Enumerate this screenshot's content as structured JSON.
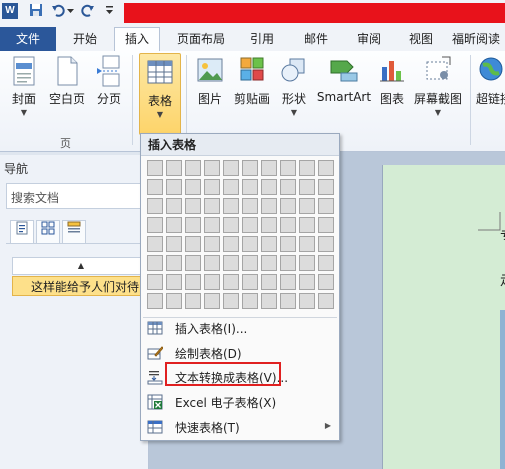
{
  "titlebar": {
    "app_icon_letter": "W",
    "qa_buttons": [
      "save-icon",
      "undo-icon",
      "undo-dropdown-icon",
      "redo-icon",
      "customize-icon"
    ]
  },
  "tabs": [
    {
      "label": "文件",
      "kind": "file"
    },
    {
      "label": "开始"
    },
    {
      "label": "插入",
      "active": true
    },
    {
      "label": "页面布局"
    },
    {
      "label": "引用"
    },
    {
      "label": "邮件"
    },
    {
      "label": "审阅"
    },
    {
      "label": "视图"
    },
    {
      "label": "福昕阅读"
    }
  ],
  "ribbon": {
    "pages_group": {
      "label": "页",
      "buttons": [
        {
          "label": "封面",
          "has_dropdown": true
        },
        {
          "label": "空白页"
        },
        {
          "label": "分页"
        }
      ]
    },
    "table_button": {
      "label": "表格",
      "has_dropdown": true
    },
    "illustrations": [
      {
        "label": "图片"
      },
      {
        "label": "剪贴画"
      },
      {
        "label": "形状",
        "has_dropdown": true
      },
      {
        "label": "SmartArt"
      },
      {
        "label": "图表"
      },
      {
        "label": "屏幕截图",
        "has_dropdown": true
      },
      {
        "label": "超链接"
      }
    ]
  },
  "nav": {
    "title": "导航",
    "search_placeholder": "搜索文档",
    "tabs": [
      "heading-view-icon",
      "page-thumbnail-icon",
      "results-view-icon"
    ],
    "up_arrow": "▲",
    "heading_item": "这样能给予人们对待"
  },
  "document": {
    "text_lines": [
      "专",
      "走"
    ]
  },
  "table_menu": {
    "header": "插入表格",
    "grid": {
      "columns": 10,
      "rows": 8
    },
    "items": [
      {
        "label": "插入表格(I)...",
        "icon": "insert-table-icon"
      },
      {
        "label": "绘制表格(D)",
        "icon": "draw-table-icon"
      },
      {
        "label": "文本转换成表格(V)...",
        "icon": "text-to-table-icon",
        "highlighted": true
      },
      {
        "label": "Excel 电子表格(X)",
        "icon": "excel-spreadsheet-icon"
      },
      {
        "label": "快速表格(T)",
        "icon": "quick-tables-icon",
        "has_submenu": true
      }
    ]
  },
  "colors": {
    "title_red": "#e8121b",
    "file_tab": "#2b579a",
    "selected_button": "#fdd46a",
    "highlight_box": "#e02020",
    "page_background": "#d4ecd4"
  }
}
